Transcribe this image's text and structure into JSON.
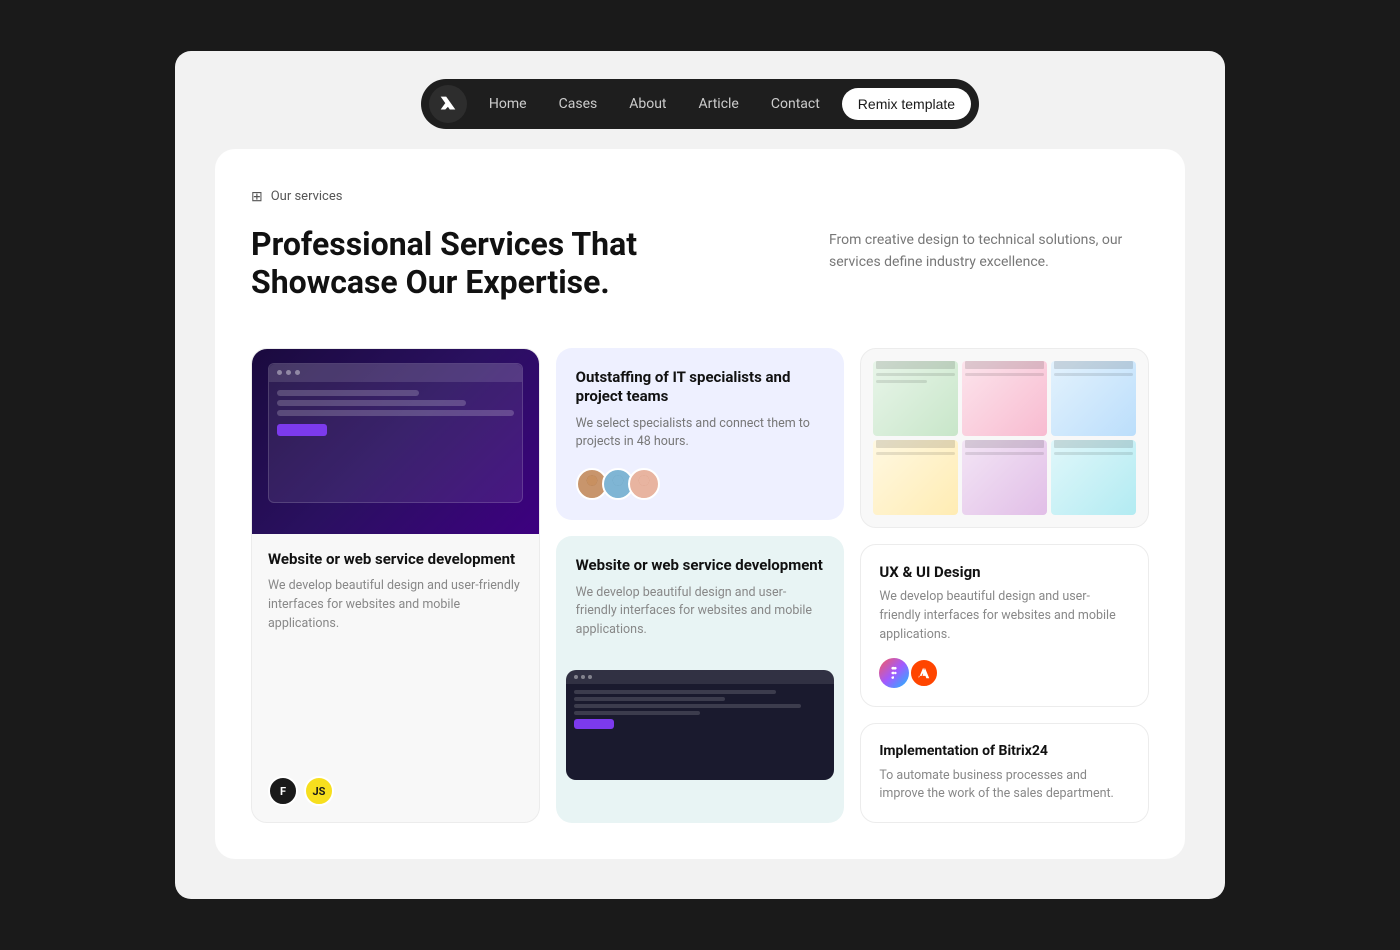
{
  "navbar": {
    "logo_symbol": "N",
    "links": [
      {
        "label": "Home",
        "id": "home"
      },
      {
        "label": "Cases",
        "id": "cases"
      },
      {
        "label": "About",
        "id": "about"
      },
      {
        "label": "Article",
        "id": "article"
      },
      {
        "label": "Contact",
        "id": "contact"
      }
    ],
    "cta_label": "Remix template"
  },
  "services": {
    "section_label": "Our services",
    "section_title": "Professional Services That Showcase Our Expertise.",
    "section_description": "From creative design to technical solutions, our services define industry excellence.",
    "cards": [
      {
        "id": "web-dev",
        "title": "Website or web service development",
        "description": "We develop beautiful design and user-friendly interfaces for websites and mobile applications.",
        "tags": [
          "F",
          "JS"
        ]
      },
      {
        "id": "outstaffing",
        "title": "Outstaffing of IT specialists and project teams",
        "description": "We select specialists and connect them to projects in 48 hours."
      },
      {
        "id": "web-dev-2",
        "title": "Website or web service development",
        "description": "We develop beautiful design and user-friendly interfaces for websites and mobile applications."
      },
      {
        "id": "ux-ui",
        "title": "UX & UI Design",
        "description": "We develop beautiful design and user-friendly interfaces for websites and mobile applications."
      },
      {
        "id": "bitrix",
        "title": "Implementation of Bitrix24",
        "description": "To automate business processes and improve the work of the sales department."
      }
    ]
  }
}
